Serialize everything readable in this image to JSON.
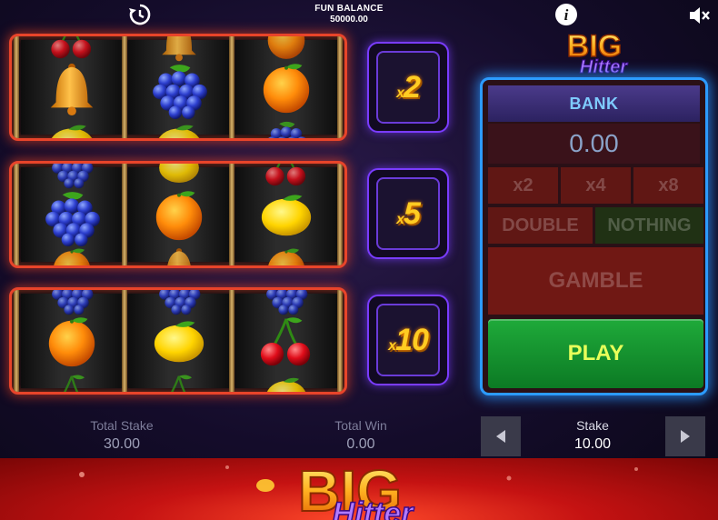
{
  "header": {
    "balance_label": "FUN BALANCE",
    "balance_value": "50000.00",
    "icons": [
      "history-icon",
      "info-icon",
      "mute-icon"
    ]
  },
  "reels": [
    {
      "top": [
        "cherry",
        "bell",
        "orange"
      ],
      "middle": [
        "bell",
        "grapes",
        "orange"
      ],
      "bottom": [
        "lemon",
        "lemon",
        "grapes"
      ],
      "multiplier_value": "2",
      "multiplier_prefix": "x"
    },
    {
      "top": [
        "grapes",
        "lemon",
        "cherry"
      ],
      "middle": [
        "grapes",
        "orange",
        "lemon"
      ],
      "bottom": [
        "orange",
        "bell",
        "orange"
      ],
      "multiplier_value": "5",
      "multiplier_prefix": "x"
    },
    {
      "top": [
        "grapes",
        "grapes",
        "grapes"
      ],
      "middle": [
        "orange",
        "lemon",
        "cherry"
      ],
      "bottom": [
        "cherry",
        "cherry",
        "lemon"
      ],
      "multiplier_value": "10",
      "multiplier_prefix": "x"
    }
  ],
  "logo": {
    "word1": "BIG",
    "word2": "Hitter"
  },
  "gamble_panel": {
    "bank_label": "BANK",
    "bank_value": "0.00",
    "x2_label": "x2",
    "x4_label": "x4",
    "x8_label": "x8",
    "double_label": "DOUBLE",
    "nothing_label": "NOTHING",
    "gamble_label": "GAMBLE",
    "play_label": "PLAY"
  },
  "footer": {
    "total_stake_label": "Total Stake",
    "total_stake_value": "30.00",
    "total_win_label": "Total Win",
    "total_win_value": "0.00",
    "stake_label": "Stake",
    "stake_value": "10.00"
  },
  "colors": {
    "reel_frame": "#e8442a",
    "multiplier_frame": "#7a3cff",
    "panel_frame": "#2c9bff",
    "play_button": "#1faa3a",
    "multiplier_text": "#ffcc22"
  }
}
